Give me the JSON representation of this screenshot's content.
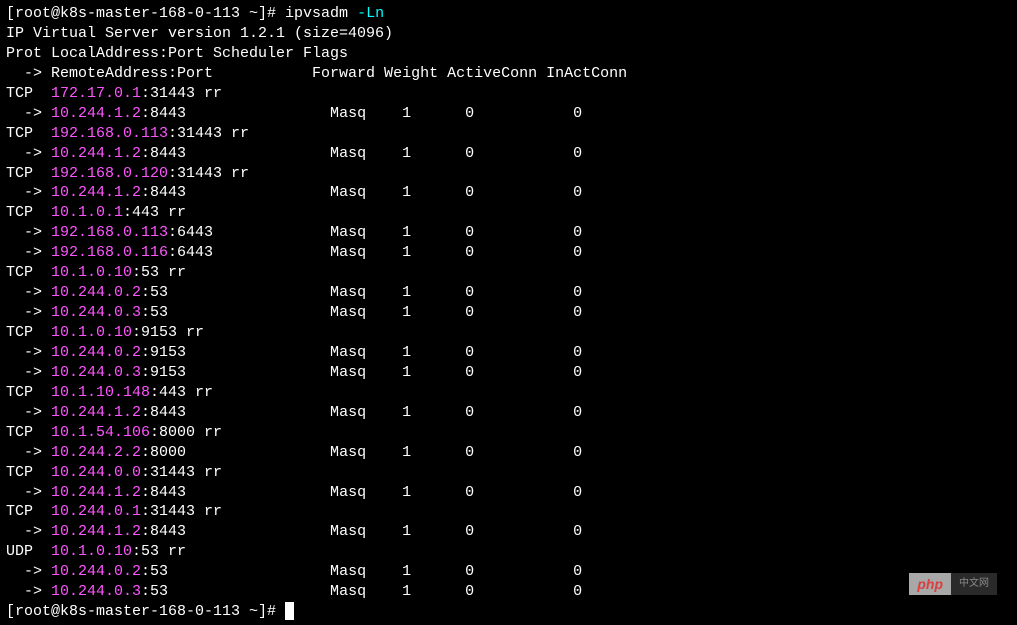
{
  "prompt1": {
    "text": "[root@k8s-master-168-0-113 ~]# ",
    "command": "ipvsadm ",
    "flag": "-Ln"
  },
  "header": {
    "version": "IP Virtual Server version 1.2.1 (size=4096)",
    "cols1": "Prot LocalAddress:Port Scheduler Flags",
    "cols2": "  -> RemoteAddress:Port           Forward Weight ActiveConn InActConn"
  },
  "entries": [
    {
      "type": "svc",
      "prot": "TCP  ",
      "ip": "172.17.0.1",
      "suffix": ":31443 rr"
    },
    {
      "type": "dst",
      "pre": "  -> ",
      "ip": "10.244.1.2",
      "port": ":8443",
      "fwd": "Masq",
      "w": "1",
      "ac": "0",
      "ic": "0"
    },
    {
      "type": "svc",
      "prot": "TCP  ",
      "ip": "192.168.0.113",
      "suffix": ":31443 rr"
    },
    {
      "type": "dst",
      "pre": "  -> ",
      "ip": "10.244.1.2",
      "port": ":8443",
      "fwd": "Masq",
      "w": "1",
      "ac": "0",
      "ic": "0"
    },
    {
      "type": "svc",
      "prot": "TCP  ",
      "ip": "192.168.0.120",
      "suffix": ":31443 rr"
    },
    {
      "type": "dst",
      "pre": "  -> ",
      "ip": "10.244.1.2",
      "port": ":8443",
      "fwd": "Masq",
      "w": "1",
      "ac": "0",
      "ic": "0"
    },
    {
      "type": "svc",
      "prot": "TCP  ",
      "ip": "10.1.0.1",
      "suffix": ":443 rr"
    },
    {
      "type": "dst",
      "pre": "  -> ",
      "ip": "192.168.0.113",
      "port": ":6443",
      "fwd": "Masq",
      "w": "1",
      "ac": "0",
      "ic": "0"
    },
    {
      "type": "dst",
      "pre": "  -> ",
      "ip": "192.168.0.116",
      "port": ":6443",
      "fwd": "Masq",
      "w": "1",
      "ac": "0",
      "ic": "0"
    },
    {
      "type": "svc",
      "prot": "TCP  ",
      "ip": "10.1.0.10",
      "suffix": ":53 rr"
    },
    {
      "type": "dst",
      "pre": "  -> ",
      "ip": "10.244.0.2",
      "port": ":53",
      "fwd": "Masq",
      "w": "1",
      "ac": "0",
      "ic": "0"
    },
    {
      "type": "dst",
      "pre": "  -> ",
      "ip": "10.244.0.3",
      "port": ":53",
      "fwd": "Masq",
      "w": "1",
      "ac": "0",
      "ic": "0"
    },
    {
      "type": "svc",
      "prot": "TCP  ",
      "ip": "10.1.0.10",
      "suffix": ":9153 rr"
    },
    {
      "type": "dst",
      "pre": "  -> ",
      "ip": "10.244.0.2",
      "port": ":9153",
      "fwd": "Masq",
      "w": "1",
      "ac": "0",
      "ic": "0"
    },
    {
      "type": "dst",
      "pre": "  -> ",
      "ip": "10.244.0.3",
      "port": ":9153",
      "fwd": "Masq",
      "w": "1",
      "ac": "0",
      "ic": "0"
    },
    {
      "type": "svc",
      "prot": "TCP  ",
      "ip": "10.1.10.148",
      "suffix": ":443 rr"
    },
    {
      "type": "dst",
      "pre": "  -> ",
      "ip": "10.244.1.2",
      "port": ":8443",
      "fwd": "Masq",
      "w": "1",
      "ac": "0",
      "ic": "0"
    },
    {
      "type": "svc",
      "prot": "TCP  ",
      "ip": "10.1.54.106",
      "suffix": ":8000 rr"
    },
    {
      "type": "dst",
      "pre": "  -> ",
      "ip": "10.244.2.2",
      "port": ":8000",
      "fwd": "Masq",
      "w": "1",
      "ac": "0",
      "ic": "0"
    },
    {
      "type": "svc",
      "prot": "TCP  ",
      "ip": "10.244.0.0",
      "suffix": ":31443 rr"
    },
    {
      "type": "dst",
      "pre": "  -> ",
      "ip": "10.244.1.2",
      "port": ":8443",
      "fwd": "Masq",
      "w": "1",
      "ac": "0",
      "ic": "0"
    },
    {
      "type": "svc",
      "prot": "TCP  ",
      "ip": "10.244.0.1",
      "suffix": ":31443 rr"
    },
    {
      "type": "dst",
      "pre": "  -> ",
      "ip": "10.244.1.2",
      "port": ":8443",
      "fwd": "Masq",
      "w": "1",
      "ac": "0",
      "ic": "0"
    },
    {
      "type": "svc",
      "prot": "UDP  ",
      "ip": "10.1.0.10",
      "suffix": ":53 rr"
    },
    {
      "type": "dst",
      "pre": "  -> ",
      "ip": "10.244.0.2",
      "port": ":53",
      "fwd": "Masq",
      "w": "1",
      "ac": "0",
      "ic": "0"
    },
    {
      "type": "dst",
      "pre": "  -> ",
      "ip": "10.244.0.3",
      "port": ":53",
      "fwd": "Masq",
      "w": "1",
      "ac": "0",
      "ic": "0"
    }
  ],
  "prompt2": {
    "text": "[root@k8s-master-168-0-113 ~]# "
  },
  "watermark": {
    "left": "php",
    "right": "中文网"
  },
  "cols": {
    "fwd": 36,
    "w": 44,
    "ac": 51,
    "ic": 63
  }
}
